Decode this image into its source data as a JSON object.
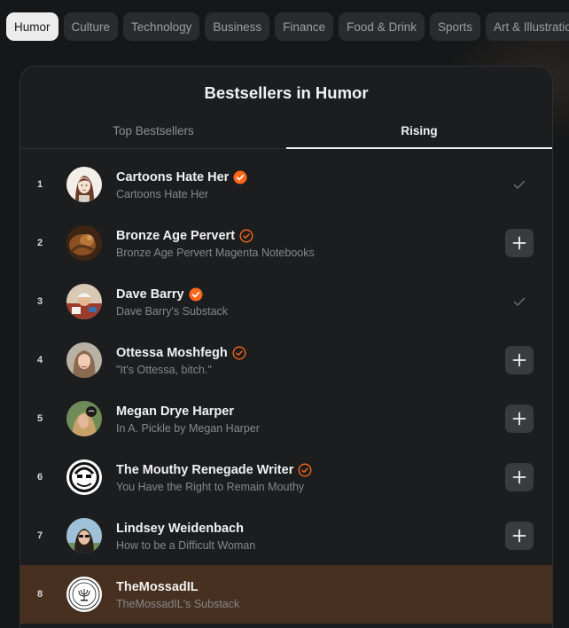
{
  "categories": [
    {
      "label": "Humor",
      "active": true
    },
    {
      "label": "Culture",
      "active": false
    },
    {
      "label": "Technology",
      "active": false
    },
    {
      "label": "Business",
      "active": false
    },
    {
      "label": "Finance",
      "active": false
    },
    {
      "label": "Food & Drink",
      "active": false
    },
    {
      "label": "Sports",
      "active": false
    },
    {
      "label": "Art & Illustration",
      "active": false
    }
  ],
  "card": {
    "title": "Bestsellers in Humor",
    "tabs": [
      {
        "label": "Top Bestsellers",
        "active": false
      },
      {
        "label": "Rising",
        "active": true
      }
    ]
  },
  "rows": [
    {
      "rank": "1",
      "name": "Cartoons Hate Her",
      "subtitle": "Cartoons Hate Her",
      "badge": "filled",
      "action": "subscribed-check-icon",
      "avatar": "avatar-cartoon"
    },
    {
      "rank": "2",
      "name": "Bronze Age Pervert",
      "subtitle": "Bronze Age Pervert Magenta Notebooks",
      "badge": "outline",
      "action": "plus-icon",
      "avatar": "avatar-bronze"
    },
    {
      "rank": "3",
      "name": "Dave Barry",
      "subtitle": "Dave Barry's Substack",
      "badge": "filled",
      "action": "subscribed-check-icon",
      "avatar": "avatar-dave"
    },
    {
      "rank": "4",
      "name": "Ottessa Moshfegh",
      "subtitle": "\"It's Ottessa, bitch.\"",
      "badge": "outline",
      "action": "plus-icon",
      "avatar": "avatar-ottessa"
    },
    {
      "rank": "5",
      "name": "Megan Drye Harper",
      "subtitle": "In A. Pickle by Megan Harper",
      "badge": "none",
      "action": "plus-icon",
      "avatar": "avatar-megan"
    },
    {
      "rank": "6",
      "name": "The Mouthy Renegade Writer",
      "subtitle": "You Have the Right to Remain Mouthy",
      "badge": "outline",
      "action": "plus-icon",
      "avatar": "avatar-mouthy"
    },
    {
      "rank": "7",
      "name": "Lindsey Weidenbach",
      "subtitle": "How to be a Difficult Woman",
      "badge": "none",
      "action": "plus-icon",
      "avatar": "avatar-lindsey"
    },
    {
      "rank": "8",
      "name": "TheMossadIL",
      "subtitle": "TheMossadIL's Substack",
      "badge": "none",
      "action": "none",
      "avatar": "avatar-mossad",
      "highlighted": true
    }
  ],
  "colors": {
    "badge": "#ff6719",
    "highlight_row": "#47301f",
    "active_tab_bg": "#ececec"
  }
}
